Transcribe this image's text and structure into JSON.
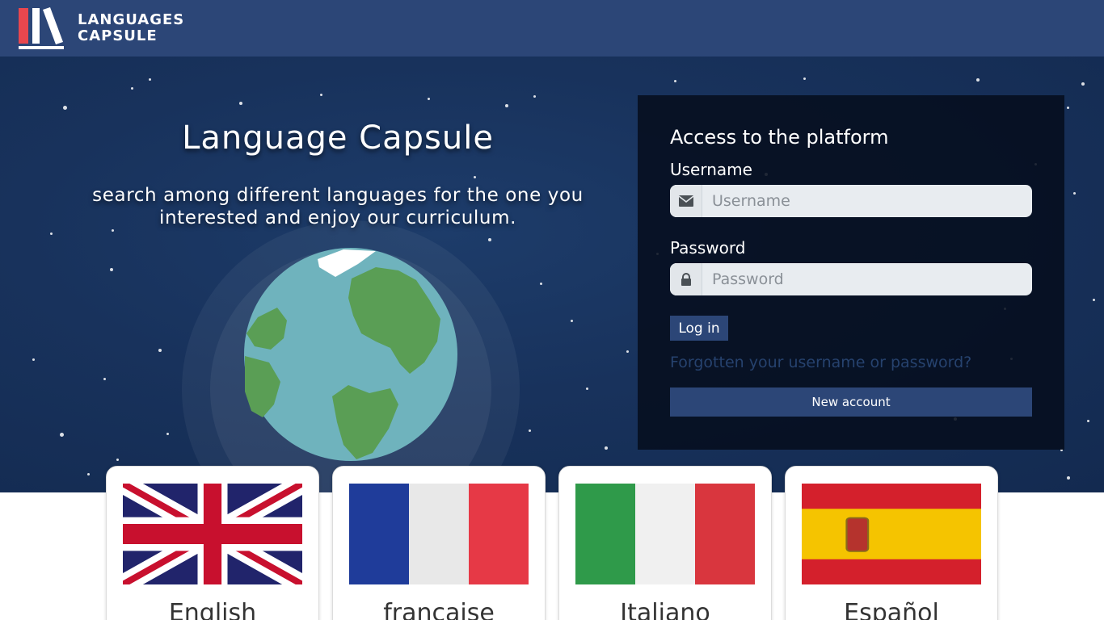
{
  "brand": {
    "line1": "LANGUAGES",
    "line2": "CAPSULE",
    "colors": {
      "navbar": "#2c4677",
      "logo_red": "#e8474e"
    }
  },
  "hero": {
    "title": "Language Capsule",
    "subtitle_line1": "search among different languages for the one you",
    "subtitle_line2": "interested and enjoy our curriculum."
  },
  "login": {
    "heading": "Access to the platform",
    "username_label": "Username",
    "username_placeholder": "Username",
    "username_icon": "envelope-icon",
    "password_label": "Password",
    "password_placeholder": "Password",
    "password_icon": "lock-icon",
    "login_button": "Log in",
    "forgot_link": "Forgotten your username or password?",
    "new_account_button": "New account"
  },
  "languages": [
    {
      "name": "English",
      "flag": "uk-flag"
    },
    {
      "name": "francaise",
      "flag": "france-flag"
    },
    {
      "name": "Italiano",
      "flag": "italy-flag"
    },
    {
      "name": "Español",
      "flag": "spain-flag"
    }
  ]
}
